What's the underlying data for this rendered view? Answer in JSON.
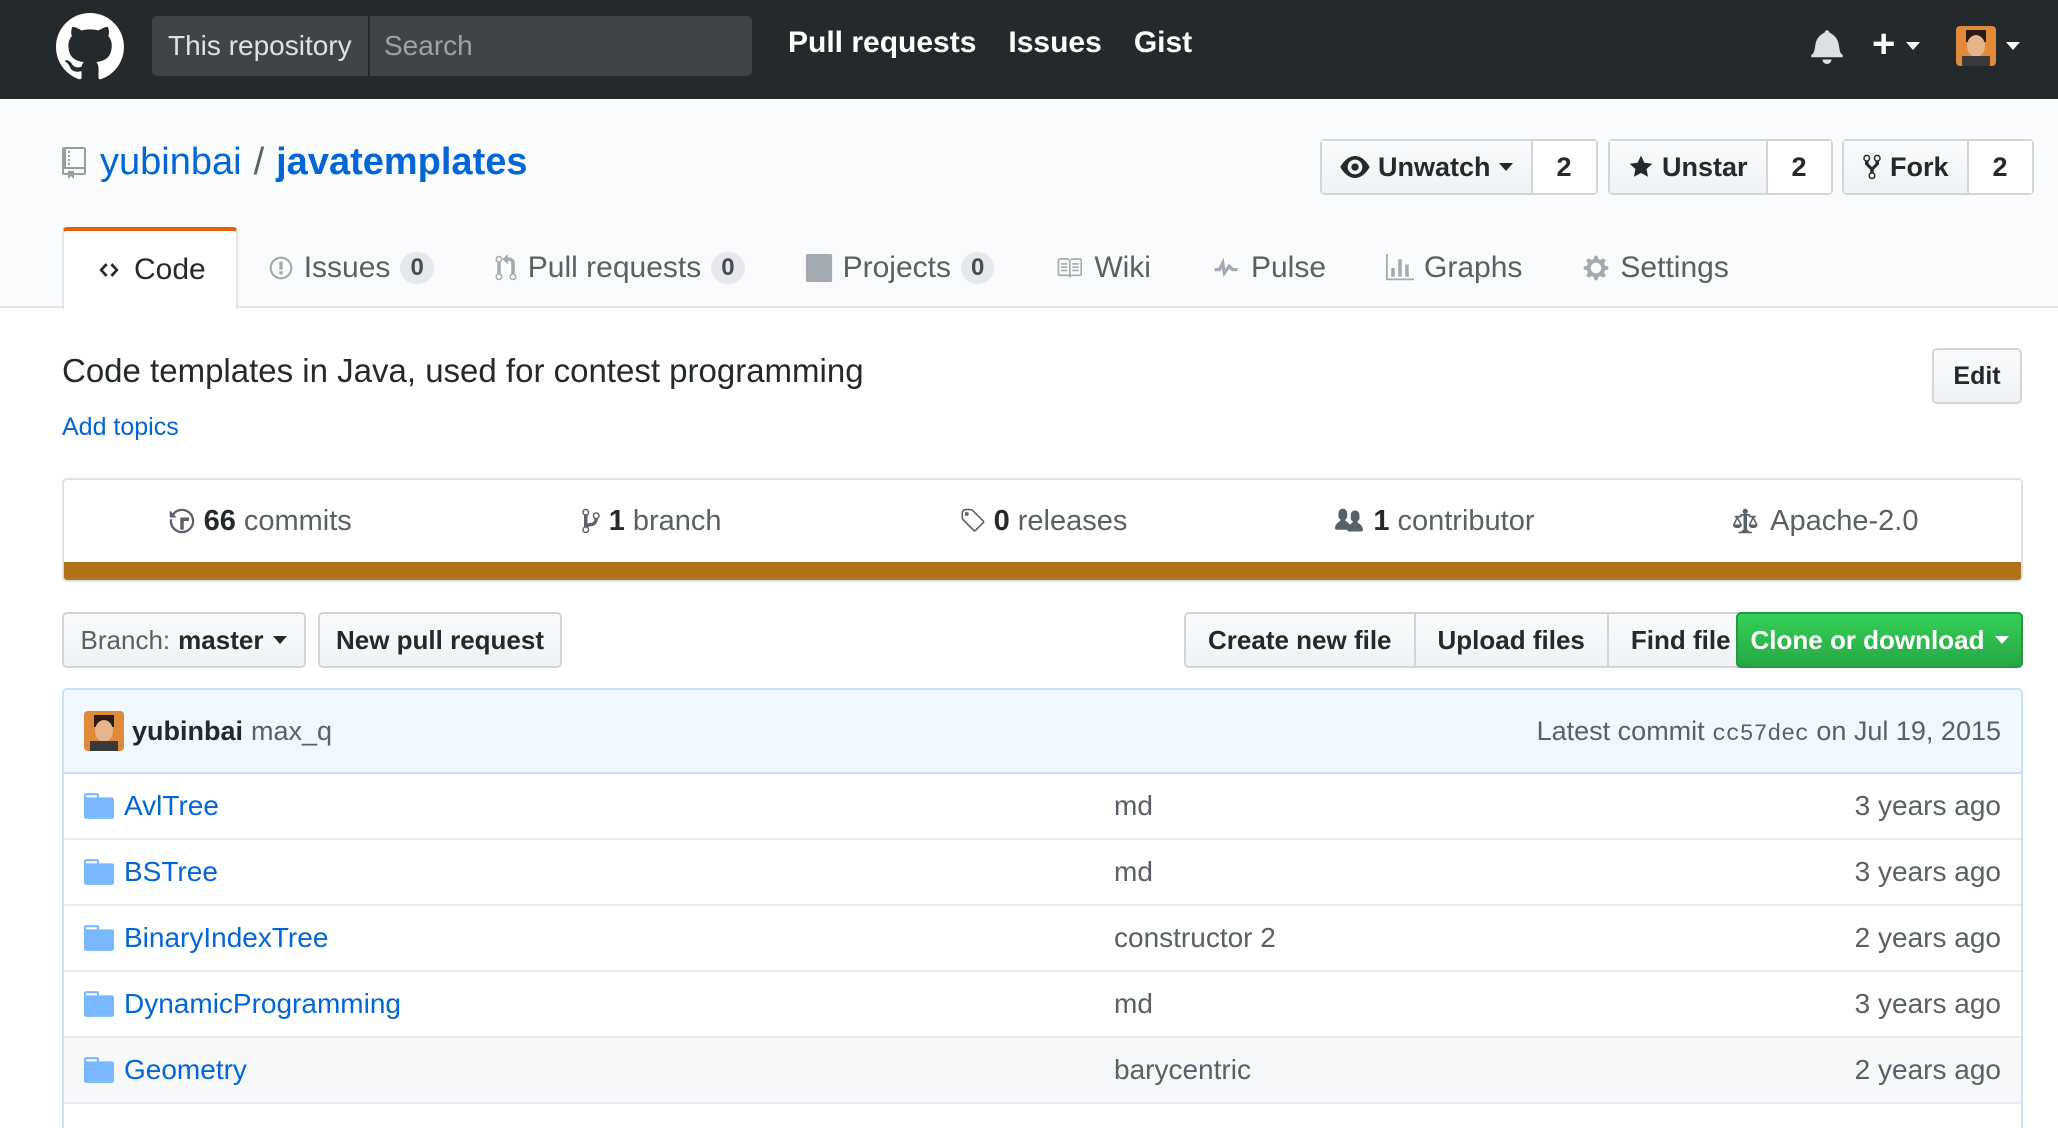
{
  "header": {
    "search_scope": "This repository",
    "search_placeholder": "Search",
    "nav": [
      "Pull requests",
      "Issues",
      "Gist"
    ],
    "plus_label": "+"
  },
  "repo": {
    "owner": "yubinbai",
    "separator": "/",
    "name": "javatemplates",
    "watch_label": "Unwatch",
    "watch_count": "2",
    "star_label": "Unstar",
    "star_count": "2",
    "fork_label": "Fork",
    "fork_count": "2"
  },
  "tabs": [
    {
      "label": "Code",
      "icon": "code-icon"
    },
    {
      "label": "Issues",
      "count": "0",
      "icon": "issue-opened-icon"
    },
    {
      "label": "Pull requests",
      "count": "0",
      "icon": "git-pull-request-icon"
    },
    {
      "label": "Projects",
      "count": "0",
      "icon": "project-icon"
    },
    {
      "label": "Wiki",
      "icon": "book-icon"
    },
    {
      "label": "Pulse",
      "icon": "pulse-icon"
    },
    {
      "label": "Graphs",
      "icon": "graph-icon"
    },
    {
      "label": "Settings",
      "icon": "gear-icon"
    }
  ],
  "description": {
    "text": "Code templates in Java, used for contest programming",
    "add_topics": "Add topics",
    "edit_label": "Edit"
  },
  "summary": {
    "commits_num": "66",
    "commits_label": "commits",
    "branch_num": "1",
    "branch_label": "branch",
    "releases_num": "0",
    "releases_label": "releases",
    "contributor_num": "1",
    "contributor_label": "contributor",
    "license": "Apache-2.0",
    "language_color": "#b07219"
  },
  "file_nav": {
    "branch_label": "Branch:",
    "branch_value": "master",
    "new_pr": "New pull request",
    "create_file": "Create new file",
    "upload_files": "Upload files",
    "find_file": "Find file",
    "clone": "Clone or download"
  },
  "commit": {
    "author": "yubinbai",
    "message": "max_q",
    "latest_label": "Latest commit",
    "sha": "cc57dec",
    "date": "on Jul 19, 2015"
  },
  "files": [
    {
      "name": "AvlTree",
      "message": "md",
      "age": "3 years ago"
    },
    {
      "name": "BSTree",
      "message": "md",
      "age": "3 years ago"
    },
    {
      "name": "BinaryIndexTree",
      "message": "constructor 2",
      "age": "2 years ago"
    },
    {
      "name": "DynamicProgramming",
      "message": "md",
      "age": "3 years ago"
    },
    {
      "name": "Geometry",
      "message": "barycentric",
      "age": "2 years ago"
    }
  ]
}
